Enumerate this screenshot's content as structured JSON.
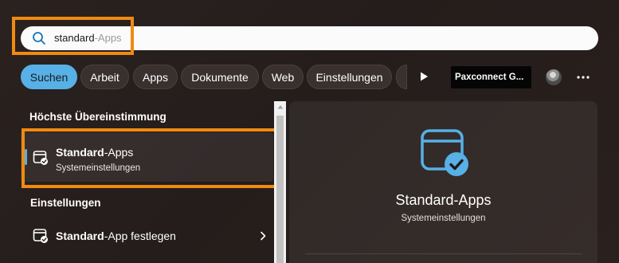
{
  "search": {
    "typed": "standard",
    "completion": "-Apps"
  },
  "filters": [
    {
      "label": "Suchen",
      "active": true
    },
    {
      "label": "Arbeit",
      "active": false
    },
    {
      "label": "Apps",
      "active": false
    },
    {
      "label": "Dokumente",
      "active": false
    },
    {
      "label": "Web",
      "active": false
    },
    {
      "label": "Einstellungen",
      "active": false
    },
    {
      "label": "",
      "active": false
    }
  ],
  "account": {
    "org_label": "Paxconnect G..."
  },
  "results": {
    "best_match_header": "Höchste Übereinstimmung",
    "best_match": {
      "title_bold": "Standard",
      "title_rest": "-Apps",
      "subtitle": "Systemeinstellungen"
    },
    "settings_header": "Einstellungen",
    "settings_items": [
      {
        "title_bold": "Standard",
        "title_rest": "-App festlegen"
      }
    ]
  },
  "preview": {
    "title": "Standard-Apps",
    "subtitle": "Systemeinstellungen"
  },
  "colors": {
    "accent": "#57b0e6",
    "highlight": "#f08a12"
  },
  "icons": {
    "search": "search-icon",
    "play": "play-icon",
    "more": "more-icon",
    "app": "default-apps-icon",
    "chevron": "chevron-right-icon"
  }
}
